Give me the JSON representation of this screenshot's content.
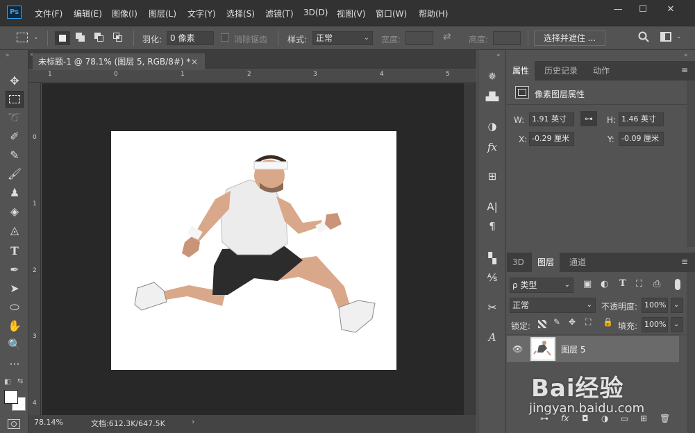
{
  "app": {
    "logo": "Ps"
  },
  "menu": [
    "文件(F)",
    "编辑(E)",
    "图像(I)",
    "图层(L)",
    "文字(Y)",
    "选择(S)",
    "滤镜(T)",
    "3D(D)",
    "视图(V)",
    "窗口(W)",
    "帮助(H)"
  ],
  "window_controls": {
    "minimize": "—",
    "maximize": "☐",
    "close": "✕"
  },
  "options": {
    "feather_label": "羽化:",
    "feather_value": "0 像素",
    "antialias_label": "消除锯齿",
    "style_label": "样式:",
    "style_value": "正常",
    "width_label": "宽度:",
    "height_label": "高度:",
    "select_mask_button": "选择并遮住 ..."
  },
  "document": {
    "tab_title": "未标题-1 @ 78.1% (图层 5, RGB/8#) *",
    "close": "×",
    "ruler_h": [
      "1",
      "0",
      "1",
      "2",
      "3",
      "4",
      "5"
    ],
    "ruler_v": [
      "0",
      "1",
      "2",
      "3",
      "4"
    ],
    "zoom": "78.14%",
    "doc_info": "文档:612.3K/647.5K"
  },
  "properties_panel": {
    "tabs": [
      "属性",
      "历史记录",
      "动作"
    ],
    "title": "像素图层属性",
    "w_label": "W:",
    "w_value": "1.91 英寸",
    "h_label": "H:",
    "h_value": "1.46 英寸",
    "x_label": "X:",
    "x_value": "-0.29 厘米",
    "y_label": "Y:",
    "y_value": "-0.09 厘米"
  },
  "layers_panel": {
    "tabs": [
      "3D",
      "图层",
      "通道"
    ],
    "kind_filter": "ρ 类型",
    "blend_mode": "正常",
    "opacity_label": "不透明度:",
    "opacity_value": "100%",
    "lock_label": "锁定:",
    "fill_label": "填充:",
    "fill_value": "100%",
    "layer_name": "图层 5"
  },
  "watermark": {
    "logo": "Bai经验",
    "url": "jingyan.baidu.com"
  },
  "colors": {
    "bg": "#535353",
    "dark": "#323232",
    "canvas": "#282828",
    "accent": "#2fa3f7"
  }
}
